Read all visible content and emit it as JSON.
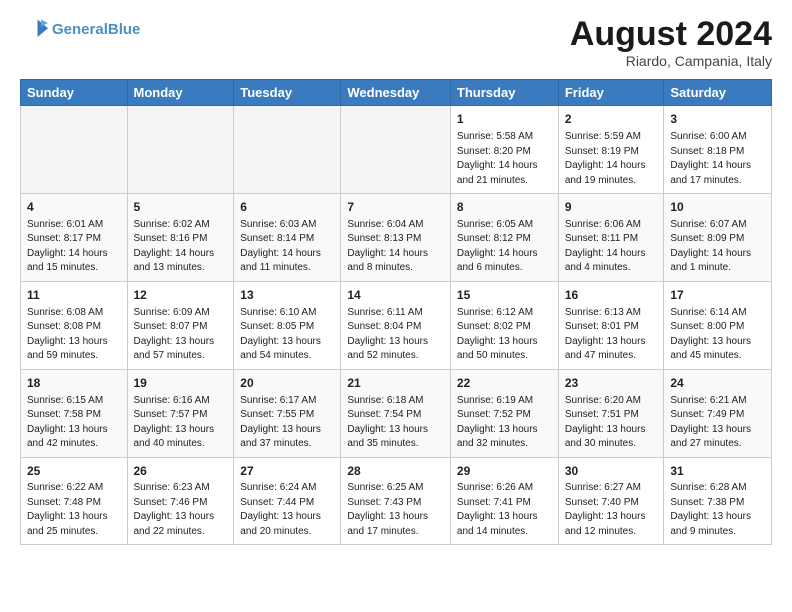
{
  "header": {
    "logo_line1": "General",
    "logo_line2": "Blue",
    "month_year": "August 2024",
    "location": "Riardo, Campania, Italy"
  },
  "days_of_week": [
    "Sunday",
    "Monday",
    "Tuesday",
    "Wednesday",
    "Thursday",
    "Friday",
    "Saturday"
  ],
  "weeks": [
    [
      {
        "day": "",
        "empty": true
      },
      {
        "day": "",
        "empty": true
      },
      {
        "day": "",
        "empty": true
      },
      {
        "day": "",
        "empty": true
      },
      {
        "day": "1",
        "info": "Sunrise: 5:58 AM\nSunset: 8:20 PM\nDaylight: 14 hours\nand 21 minutes."
      },
      {
        "day": "2",
        "info": "Sunrise: 5:59 AM\nSunset: 8:19 PM\nDaylight: 14 hours\nand 19 minutes."
      },
      {
        "day": "3",
        "info": "Sunrise: 6:00 AM\nSunset: 8:18 PM\nDaylight: 14 hours\nand 17 minutes."
      }
    ],
    [
      {
        "day": "4",
        "info": "Sunrise: 6:01 AM\nSunset: 8:17 PM\nDaylight: 14 hours\nand 15 minutes."
      },
      {
        "day": "5",
        "info": "Sunrise: 6:02 AM\nSunset: 8:16 PM\nDaylight: 14 hours\nand 13 minutes."
      },
      {
        "day": "6",
        "info": "Sunrise: 6:03 AM\nSunset: 8:14 PM\nDaylight: 14 hours\nand 11 minutes."
      },
      {
        "day": "7",
        "info": "Sunrise: 6:04 AM\nSunset: 8:13 PM\nDaylight: 14 hours\nand 8 minutes."
      },
      {
        "day": "8",
        "info": "Sunrise: 6:05 AM\nSunset: 8:12 PM\nDaylight: 14 hours\nand 6 minutes."
      },
      {
        "day": "9",
        "info": "Sunrise: 6:06 AM\nSunset: 8:11 PM\nDaylight: 14 hours\nand 4 minutes."
      },
      {
        "day": "10",
        "info": "Sunrise: 6:07 AM\nSunset: 8:09 PM\nDaylight: 14 hours\nand 1 minute."
      }
    ],
    [
      {
        "day": "11",
        "info": "Sunrise: 6:08 AM\nSunset: 8:08 PM\nDaylight: 13 hours\nand 59 minutes."
      },
      {
        "day": "12",
        "info": "Sunrise: 6:09 AM\nSunset: 8:07 PM\nDaylight: 13 hours\nand 57 minutes."
      },
      {
        "day": "13",
        "info": "Sunrise: 6:10 AM\nSunset: 8:05 PM\nDaylight: 13 hours\nand 54 minutes."
      },
      {
        "day": "14",
        "info": "Sunrise: 6:11 AM\nSunset: 8:04 PM\nDaylight: 13 hours\nand 52 minutes."
      },
      {
        "day": "15",
        "info": "Sunrise: 6:12 AM\nSunset: 8:02 PM\nDaylight: 13 hours\nand 50 minutes."
      },
      {
        "day": "16",
        "info": "Sunrise: 6:13 AM\nSunset: 8:01 PM\nDaylight: 13 hours\nand 47 minutes."
      },
      {
        "day": "17",
        "info": "Sunrise: 6:14 AM\nSunset: 8:00 PM\nDaylight: 13 hours\nand 45 minutes."
      }
    ],
    [
      {
        "day": "18",
        "info": "Sunrise: 6:15 AM\nSunset: 7:58 PM\nDaylight: 13 hours\nand 42 minutes."
      },
      {
        "day": "19",
        "info": "Sunrise: 6:16 AM\nSunset: 7:57 PM\nDaylight: 13 hours\nand 40 minutes."
      },
      {
        "day": "20",
        "info": "Sunrise: 6:17 AM\nSunset: 7:55 PM\nDaylight: 13 hours\nand 37 minutes."
      },
      {
        "day": "21",
        "info": "Sunrise: 6:18 AM\nSunset: 7:54 PM\nDaylight: 13 hours\nand 35 minutes."
      },
      {
        "day": "22",
        "info": "Sunrise: 6:19 AM\nSunset: 7:52 PM\nDaylight: 13 hours\nand 32 minutes."
      },
      {
        "day": "23",
        "info": "Sunrise: 6:20 AM\nSunset: 7:51 PM\nDaylight: 13 hours\nand 30 minutes."
      },
      {
        "day": "24",
        "info": "Sunrise: 6:21 AM\nSunset: 7:49 PM\nDaylight: 13 hours\nand 27 minutes."
      }
    ],
    [
      {
        "day": "25",
        "info": "Sunrise: 6:22 AM\nSunset: 7:48 PM\nDaylight: 13 hours\nand 25 minutes."
      },
      {
        "day": "26",
        "info": "Sunrise: 6:23 AM\nSunset: 7:46 PM\nDaylight: 13 hours\nand 22 minutes."
      },
      {
        "day": "27",
        "info": "Sunrise: 6:24 AM\nSunset: 7:44 PM\nDaylight: 13 hours\nand 20 minutes."
      },
      {
        "day": "28",
        "info": "Sunrise: 6:25 AM\nSunset: 7:43 PM\nDaylight: 13 hours\nand 17 minutes."
      },
      {
        "day": "29",
        "info": "Sunrise: 6:26 AM\nSunset: 7:41 PM\nDaylight: 13 hours\nand 14 minutes."
      },
      {
        "day": "30",
        "info": "Sunrise: 6:27 AM\nSunset: 7:40 PM\nDaylight: 13 hours\nand 12 minutes."
      },
      {
        "day": "31",
        "info": "Sunrise: 6:28 AM\nSunset: 7:38 PM\nDaylight: 13 hours\nand 9 minutes."
      }
    ]
  ]
}
